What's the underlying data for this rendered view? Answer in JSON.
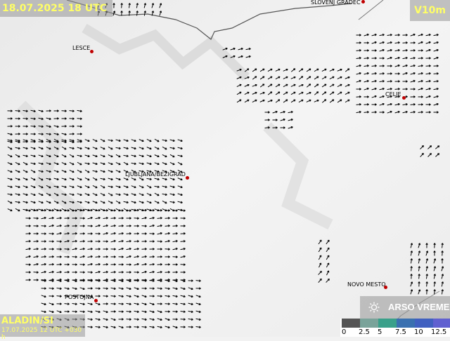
{
  "header": {
    "title": "18.07.2025 18 UTC",
    "parameter": "V10m"
  },
  "model": {
    "name": "ALADIN/SI",
    "run": "17.07.2025 12 UTC +030 h"
  },
  "brand": {
    "name": "ARSO VREME"
  },
  "legend": {
    "ticks": [
      "0",
      "2.5",
      "5",
      "7.5",
      "10",
      "12.5"
    ],
    "colors": [
      "#555555",
      "#7aa39a",
      "#3aa08a",
      "#3a70b0",
      "#4060c0",
      "#6060d0"
    ]
  },
  "cities": [
    {
      "name": "SLOVENJ GRADEC"
    },
    {
      "name": "LESCE"
    },
    {
      "name": "CELJE"
    },
    {
      "name": "LJUBLJANA/BEŽIGRAD"
    },
    {
      "name": "NOVO MESTO"
    },
    {
      "name": "POSTOJNA"
    }
  ],
  "colors": {
    "label_text": "#ffff66",
    "panel": "#969696",
    "station": "#c00000",
    "arrow": "#000000"
  }
}
